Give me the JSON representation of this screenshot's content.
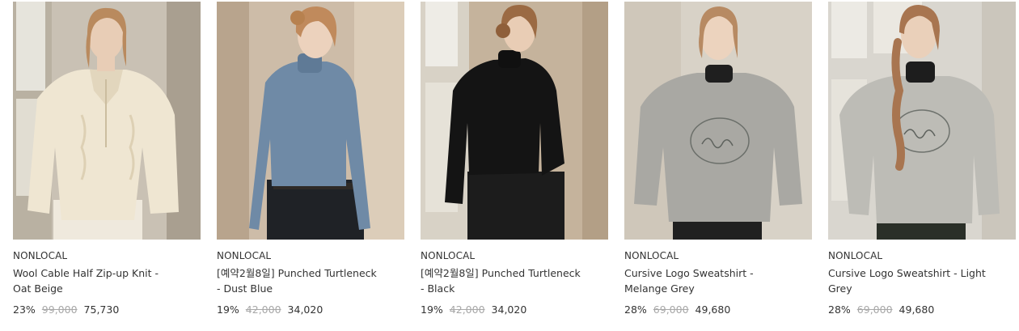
{
  "products": [
    {
      "brand": "NONLOCAL",
      "name": "Wool Cable Half Zip-up Knit - Oat Beige",
      "discount": "23%",
      "original_price": "99,000",
      "sale_price": "75,730",
      "image": "model-in-oat-beige-cable-knit",
      "colors": {
        "bg": "#c9c1b4",
        "garment": "#efe6d2",
        "skin": "#e8cdb6",
        "hair": "#b98a5e",
        "pants": "#efe9dd"
      }
    },
    {
      "brand": "NONLOCAL",
      "name": "[예약2월8일] Punched Turtleneck - Dust Blue",
      "discount": "19%",
      "original_price": "42,000",
      "sale_price": "34,020",
      "image": "model-in-dust-blue-turtleneck",
      "colors": {
        "bg": "#cdbca8",
        "garment": "#6f8aa6",
        "skin": "#ecd2bd",
        "hair": "#c08a5c",
        "pants": "#1f2226"
      }
    },
    {
      "brand": "NONLOCAL",
      "name": "[예약2월8일] Punched Turtleneck - Black",
      "discount": "19%",
      "original_price": "42,000",
      "sale_price": "34,020",
      "image": "model-in-black-turtleneck",
      "colors": {
        "bg": "#c5b39c",
        "garment": "#141414",
        "skin": "#e9cdb5",
        "hair": "#9b6a43",
        "pants": "#1c1c1c"
      }
    },
    {
      "brand": "NONLOCAL",
      "name": "Cursive Logo Sweatshirt - Melange Grey",
      "discount": "28%",
      "original_price": "69,000",
      "sale_price": "49,680",
      "image": "model-in-melange-grey-logo-sweatshirt",
      "colors": {
        "bg": "#d8d2c7",
        "garment": "#a9a8a3",
        "skin": "#ecd3be",
        "hair": "#b78a63",
        "pants": "#202020"
      }
    },
    {
      "brand": "NONLOCAL",
      "name": "Cursive Logo Sweatshirt - Light Grey",
      "discount": "28%",
      "original_price": "69,000",
      "sale_price": "49,680",
      "image": "model-in-light-grey-logo-sweatshirt",
      "colors": {
        "bg": "#d9d6cf",
        "garment": "#bdbcb6",
        "skin": "#ead0ba",
        "hair": "#a87550",
        "pants": "#2a2f28"
      }
    }
  ]
}
